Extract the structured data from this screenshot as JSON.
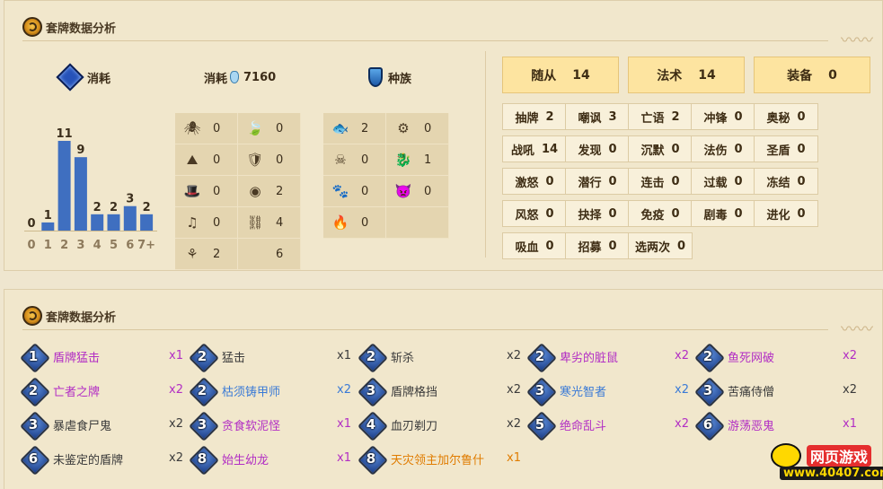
{
  "panel1": {
    "title": "套牌数据分析",
    "mana_label": "消耗",
    "dust_label": "消耗",
    "dust_value": "7160",
    "race_label": "种族"
  },
  "curve": {
    "labels": [
      "0",
      "1",
      "2",
      "3",
      "4",
      "5",
      "6",
      "7+"
    ],
    "values": [
      0,
      1,
      11,
      9,
      2,
      2,
      3,
      2
    ]
  },
  "grid_left": [
    {
      "icon": "spider-icon",
      "glyph": "🕷",
      "value": "0"
    },
    {
      "icon": "leaf-icon",
      "glyph": "🍃",
      "value": "0"
    },
    {
      "icon": "mountain-icon",
      "glyph": "⛰",
      "value": "0"
    },
    {
      "icon": "crest-shield-icon",
      "glyph": "🛡",
      "value": "0"
    },
    {
      "icon": "hat-icon",
      "glyph": "🎩",
      "value": "0"
    },
    {
      "icon": "void-orb-icon",
      "glyph": "◉",
      "value": "2"
    },
    {
      "icon": "music-note-icon",
      "glyph": "♫",
      "value": "0"
    },
    {
      "icon": "gold-chain-icon",
      "glyph": "⛓",
      "value": "4"
    },
    {
      "icon": "claw-icon",
      "glyph": "⚘",
      "value": "2"
    },
    {
      "icon": "blank-icon",
      "glyph": "",
      "value": "6"
    }
  ],
  "grid_right": [
    {
      "icon": "murloc-icon",
      "glyph": "🐟",
      "value": "2"
    },
    {
      "icon": "gear-icon",
      "glyph": "⚙",
      "value": "0"
    },
    {
      "icon": "pirate-skull-icon",
      "glyph": "☠",
      "value": "0"
    },
    {
      "icon": "dragon-icon",
      "glyph": "🐉",
      "value": "1"
    },
    {
      "icon": "paw-icon",
      "glyph": "🐾",
      "value": "0"
    },
    {
      "icon": "demon-icon",
      "glyph": "👿",
      "value": "0"
    },
    {
      "icon": "elemental-icon",
      "glyph": "🔥",
      "value": "0"
    },
    {
      "icon": "empty-icon",
      "glyph": "",
      "value": ""
    }
  ],
  "type_totals": [
    {
      "label": "随从",
      "value": "14"
    },
    {
      "label": "法术",
      "value": "14"
    },
    {
      "label": "装备",
      "value": "0"
    }
  ],
  "keywords": [
    {
      "label": "抽牌",
      "value": "2"
    },
    {
      "label": "嘲讽",
      "value": "3"
    },
    {
      "label": "亡语",
      "value": "2"
    },
    {
      "label": "冲锋",
      "value": "0"
    },
    {
      "label": "奥秘",
      "value": "0"
    },
    {
      "label": "战吼",
      "value": "14"
    },
    {
      "label": "发现",
      "value": "0"
    },
    {
      "label": "沉默",
      "value": "0"
    },
    {
      "label": "法伤",
      "value": "0"
    },
    {
      "label": "圣盾",
      "value": "0"
    },
    {
      "label": "激怒",
      "value": "0"
    },
    {
      "label": "潜行",
      "value": "0"
    },
    {
      "label": "连击",
      "value": "0"
    },
    {
      "label": "过载",
      "value": "0"
    },
    {
      "label": "冻结",
      "value": "0"
    },
    {
      "label": "风怒",
      "value": "0"
    },
    {
      "label": "抉择",
      "value": "0"
    },
    {
      "label": "免疫",
      "value": "0"
    },
    {
      "label": "剧毒",
      "value": "0"
    },
    {
      "label": "进化",
      "value": "0"
    },
    {
      "label": "吸血",
      "value": "0"
    },
    {
      "label": "招募",
      "value": "0"
    },
    {
      "label": "选两次",
      "value": "0"
    }
  ],
  "panel2": {
    "title": "套牌数据分析"
  },
  "cards": [
    {
      "cost": "1",
      "name": "盾牌猛击",
      "qty": "x1",
      "rarity": "epic"
    },
    {
      "cost": "2",
      "name": "猛击",
      "qty": "x1",
      "rarity": "common"
    },
    {
      "cost": "2",
      "name": "斩杀",
      "qty": "x2",
      "rarity": "common"
    },
    {
      "cost": "2",
      "name": "卑劣的脏鼠",
      "qty": "x2",
      "rarity": "epic"
    },
    {
      "cost": "2",
      "name": "鱼死网破",
      "qty": "x2",
      "rarity": "epic"
    },
    {
      "cost": "2",
      "name": "亡者之牌",
      "qty": "x2",
      "rarity": "epic"
    },
    {
      "cost": "2",
      "name": "枯须铸甲师",
      "qty": "x2",
      "rarity": "rare"
    },
    {
      "cost": "3",
      "name": "盾牌格挡",
      "qty": "x2",
      "rarity": "common"
    },
    {
      "cost": "3",
      "name": "寒光智者",
      "qty": "x2",
      "rarity": "rare"
    },
    {
      "cost": "3",
      "name": "苦痛侍僧",
      "qty": "x2",
      "rarity": "common"
    },
    {
      "cost": "3",
      "name": "暴虐食尸鬼",
      "qty": "x2",
      "rarity": "common"
    },
    {
      "cost": "3",
      "name": "贪食软泥怪",
      "qty": "x1",
      "rarity": "epic"
    },
    {
      "cost": "4",
      "name": "血刃剃刀",
      "qty": "x2",
      "rarity": "common"
    },
    {
      "cost": "5",
      "name": "绝命乱斗",
      "qty": "x2",
      "rarity": "epic"
    },
    {
      "cost": "6",
      "name": "游荡恶鬼",
      "qty": "x1",
      "rarity": "epic"
    },
    {
      "cost": "6",
      "name": "未鉴定的盾牌",
      "qty": "x2",
      "rarity": "common"
    },
    {
      "cost": "8",
      "name": "始生幼龙",
      "qty": "x1",
      "rarity": "epic"
    },
    {
      "cost": "8",
      "name": "天灾领主加尔鲁什",
      "qty": "x1",
      "rarity": "legend"
    }
  ],
  "colors": {
    "bar": "#3f6fc0",
    "common": "#3b3b3b",
    "rare": "#3a7ad6",
    "epic": "#b22ec4",
    "legend": "#e07c00"
  },
  "logo": {
    "line1": "网页游戏",
    "line2": "www.40407.com"
  }
}
